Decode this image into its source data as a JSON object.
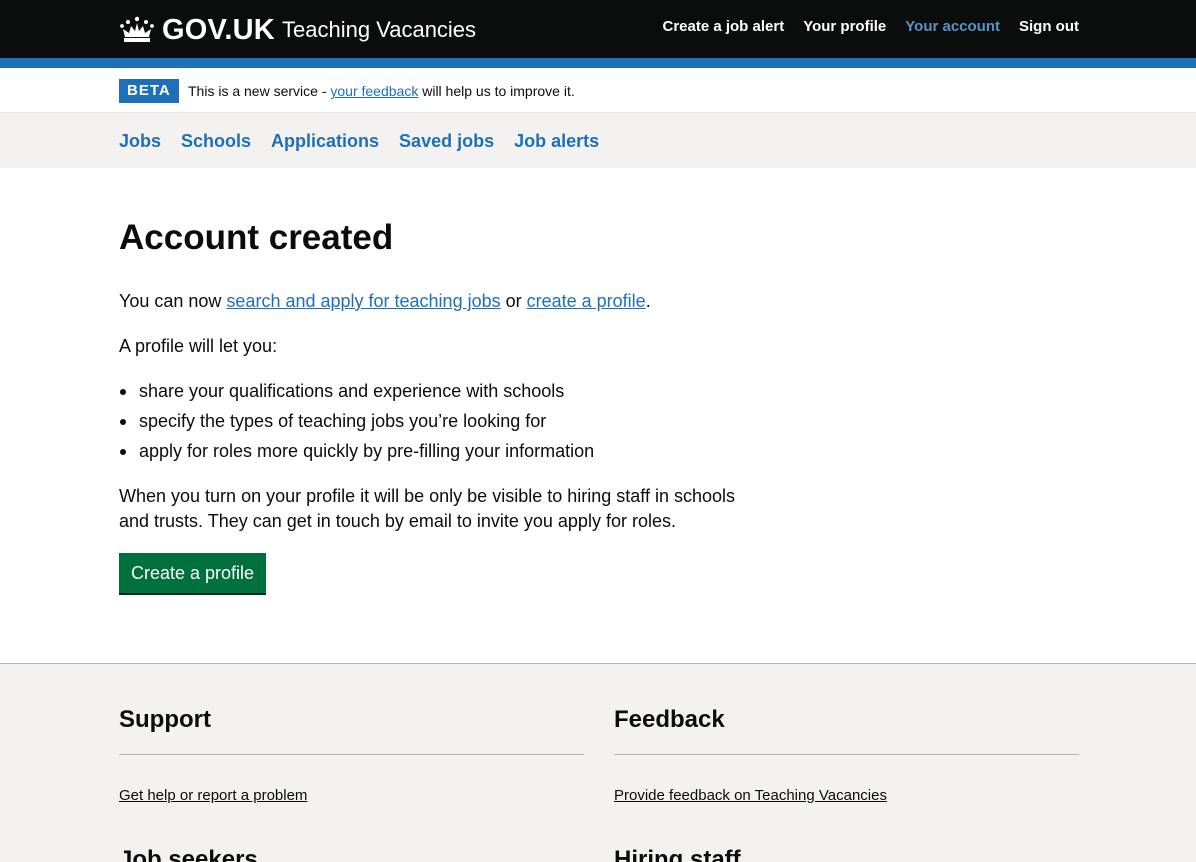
{
  "header": {
    "logo_text": "GOV.UK",
    "service_name": "Teaching Vacancies",
    "nav": [
      {
        "label": "Create a job alert"
      },
      {
        "label": "Your profile"
      },
      {
        "label": "Your account"
      },
      {
        "label": "Sign out"
      }
    ],
    "active_nav": "Your account",
    "accent_color": "#1d70b8",
    "active_color": "#5694ca"
  },
  "beta": {
    "tag": "BETA",
    "text_before": "This is a new service - ",
    "link": "your feedback",
    "text_after": " will help us to improve it."
  },
  "subnav": {
    "items": [
      {
        "label": "Jobs"
      },
      {
        "label": "Schools"
      },
      {
        "label": "Applications"
      },
      {
        "label": "Saved jobs"
      },
      {
        "label": "Job alerts"
      }
    ]
  },
  "main": {
    "title": "Account created",
    "p1_before": "You can now ",
    "p1_link1": "search and apply for teaching jobs",
    "p1_middle": " or ",
    "p1_link2": "create a profile",
    "p1_after": ".",
    "p2": "A profile will let you:",
    "bullets": [
      "share your qualifications and experience with schools",
      "specify the types of teaching jobs you’re looking for",
      "apply for roles more quickly by pre-filling your information"
    ],
    "p3": "When you turn on your profile it will be only be visible to hiring staff in schools and trusts. They can get in touch by email to invite you apply for roles.",
    "cta_label": "Create a profile",
    "cta_color": "#00703c"
  },
  "footer": {
    "support": {
      "heading": "Support",
      "link": "Get help or report a problem"
    },
    "feedback": {
      "heading": "Feedback",
      "link": "Provide feedback on Teaching Vacancies"
    },
    "job_seekers": {
      "heading": "Job seekers"
    },
    "hiring_staff": {
      "heading": "Hiring staff"
    }
  }
}
